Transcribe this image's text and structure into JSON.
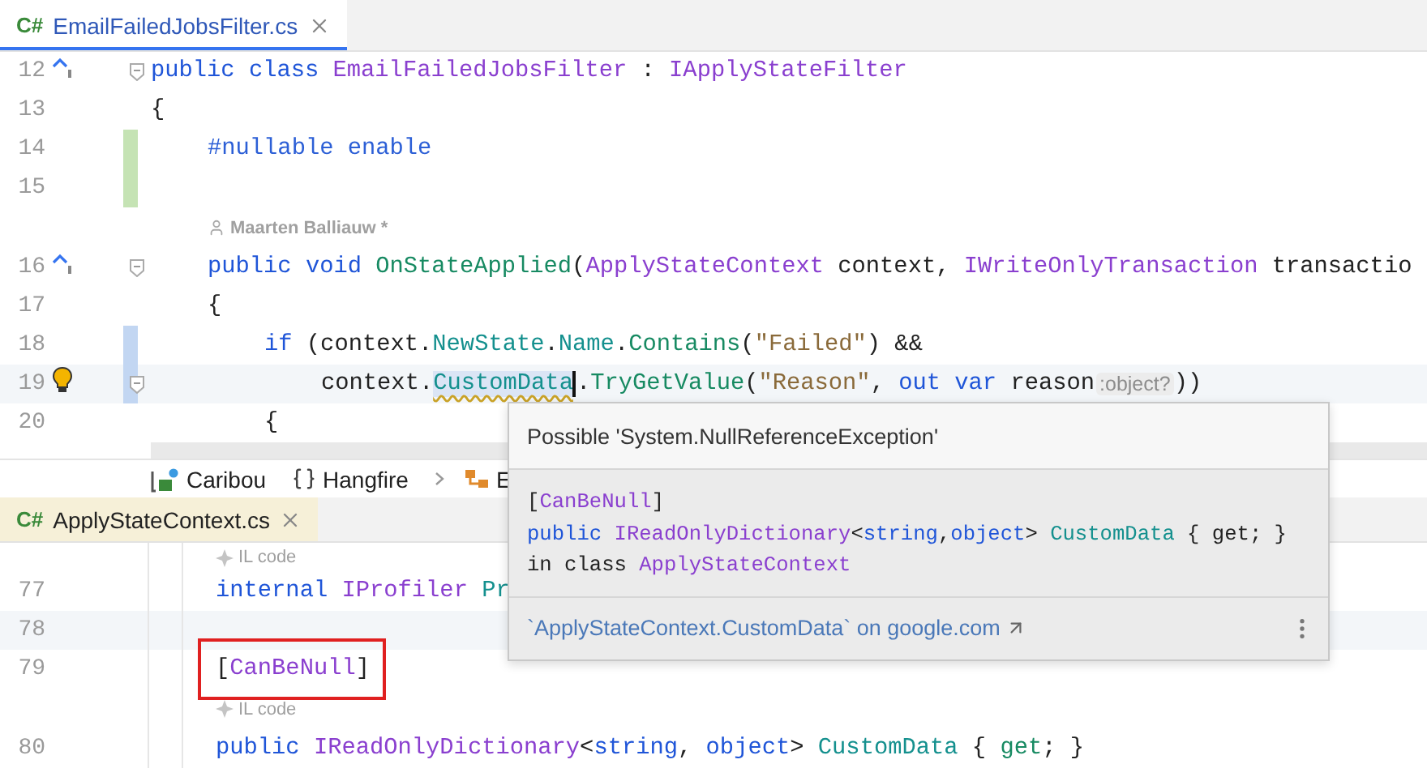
{
  "top_editor": {
    "tab": {
      "lang": "C#",
      "title": "EmailFailedJobsFilter.cs",
      "selected": true,
      "external": false
    },
    "lines": [
      {
        "kind": "code",
        "number": "12",
        "implements": true,
        "bulb": false,
        "added": false,
        "modified": false,
        "fold": true,
        "current": false,
        "tokens": [
          {
            "text": "public class ",
            "kind": "keyword"
          },
          {
            "text": "EmailFailedJobsFilter",
            "kind": "type"
          },
          {
            "text": " : ",
            "kind": "plain"
          },
          {
            "text": "IApplyStateFilter",
            "kind": "type"
          }
        ]
      },
      {
        "kind": "code",
        "number": "13",
        "implements": false,
        "bulb": false,
        "added": false,
        "modified": false,
        "fold": false,
        "current": false,
        "tokens": [
          {
            "text": "{",
            "kind": "plain"
          }
        ],
        "children": [
          {
            "kind": "code",
            "number": "14",
            "implements": false,
            "bulb": false,
            "added": true,
            "modified": false,
            "fold": false,
            "current": false,
            "tokens": [
              {
                "text": "#nullable enable",
                "kind": "directive"
              }
            ]
          },
          {
            "kind": "code",
            "number": "15",
            "implements": false,
            "bulb": false,
            "added": true,
            "modified": false,
            "fold": false,
            "current": false
          },
          {
            "kind": "author",
            "text": "Maarten Balliauw *"
          },
          {
            "kind": "code",
            "number": "16",
            "implements": true,
            "bulb": false,
            "added": false,
            "modified": false,
            "fold": true,
            "current": false,
            "tokens": [
              {
                "text": "public void ",
                "kind": "keyword"
              },
              {
                "text": "OnStateApplied",
                "kind": "method"
              },
              {
                "text": "(",
                "kind": "plain"
              },
              {
                "text": "ApplyStateContext",
                "kind": "type"
              },
              {
                "text": " context, ",
                "kind": "plain"
              },
              {
                "text": "IWriteOnlyTransaction",
                "kind": "type"
              },
              {
                "text": " transactio",
                "kind": "plain"
              }
            ]
          },
          {
            "kind": "code",
            "number": "17",
            "implements": false,
            "bulb": false,
            "added": false,
            "modified": false,
            "fold": false,
            "current": false,
            "tokens": [
              {
                "text": "{",
                "kind": "plain"
              }
            ],
            "children": [
              {
                "kind": "code",
                "number": "18",
                "implements": false,
                "bulb": false,
                "added": false,
                "modified": true,
                "fold": false,
                "current": false,
                "tokens": [
                  {
                    "text": "if ",
                    "kind": "keyword"
                  },
                  {
                    "text": "(context.",
                    "kind": "plain"
                  },
                  {
                    "text": "NewState",
                    "kind": "property"
                  },
                  {
                    "text": ".",
                    "kind": "plain"
                  },
                  {
                    "text": "Name",
                    "kind": "property"
                  },
                  {
                    "text": ".",
                    "kind": "plain"
                  },
                  {
                    "text": "Contains",
                    "kind": "method"
                  },
                  {
                    "text": "(",
                    "kind": "plain"
                  },
                  {
                    "text": "\"Failed\"",
                    "kind": "string"
                  },
                  {
                    "text": ") &&",
                    "kind": "plain"
                  }
                ],
                "children": [
                  {
                    "kind": "code",
                    "number": "19",
                    "implements": false,
                    "bulb": true,
                    "added": false,
                    "modified": true,
                    "fold": true,
                    "current": true,
                    "tokens": [
                      {
                        "text": "context.",
                        "kind": "plain"
                      },
                      {
                        "text": "CustomData",
                        "kind": "flagged"
                      },
                      {
                        "text": ".",
                        "kind": "plain"
                      },
                      {
                        "text": "TryGetValue",
                        "kind": "method"
                      },
                      {
                        "text": "(",
                        "kind": "plain"
                      },
                      {
                        "text": "\"Reason\"",
                        "kind": "string"
                      },
                      {
                        "text": ", ",
                        "kind": "plain"
                      },
                      {
                        "text": "out var ",
                        "kind": "keyword"
                      },
                      {
                        "text": "reason",
                        "kind": "plain"
                      },
                      {
                        "text": ":object?",
                        "kind": "hint"
                      },
                      {
                        "text": "))",
                        "kind": "plain"
                      }
                    ]
                  }
                ]
              },
              {
                "kind": "code",
                "number": "20",
                "implements": false,
                "bulb": false,
                "added": false,
                "modified": false,
                "fold": false,
                "current": false,
                "tokens": [
                  {
                    "text": "{",
                    "kind": "plain"
                  }
                ]
              }
            ]
          }
        ]
      }
    ]
  },
  "breadcrumbs": [
    {
      "kind": "project",
      "label": "Caribou"
    },
    {
      "kind": "namespace",
      "label": "Hangfire"
    },
    {
      "kind": "separator"
    },
    {
      "kind": "class",
      "label": "E"
    }
  ],
  "bottom_editor": {
    "tab": {
      "lang": "C#",
      "title": "ApplyStateContext.cs",
      "selected": false,
      "external": true
    },
    "lines": [
      {
        "kind": "il",
        "text": "IL code"
      },
      {
        "kind": "code",
        "number": "77",
        "current": false,
        "framed": false,
        "tokens": [
          {
            "text": "internal ",
            "kind": "keyword"
          },
          {
            "text": "IProfiler ",
            "kind": "type"
          },
          {
            "text": "Pr",
            "kind": "property"
          }
        ]
      },
      {
        "kind": "code",
        "number": "78",
        "current": true,
        "framed": false
      },
      {
        "kind": "code",
        "number": "79",
        "current": false,
        "framed": true,
        "tokens": [
          {
            "text": "[",
            "kind": "plain"
          },
          {
            "text": "CanBeNull",
            "kind": "type"
          },
          {
            "text": "]",
            "kind": "plain"
          }
        ]
      },
      {
        "kind": "il",
        "text": "IL code"
      },
      {
        "kind": "code",
        "number": "80",
        "current": false,
        "framed": false,
        "tokens": [
          {
            "text": "public ",
            "kind": "keyword"
          },
          {
            "text": "IReadOnlyDictionary",
            "kind": "type"
          },
          {
            "text": "<",
            "kind": "plain"
          },
          {
            "text": "string",
            "kind": "keyword"
          },
          {
            "text": ", ",
            "kind": "plain"
          },
          {
            "text": "object",
            "kind": "keyword"
          },
          {
            "text": "> ",
            "kind": "plain"
          },
          {
            "text": "CustomData",
            "kind": "property"
          },
          {
            "text": " { ",
            "kind": "plain"
          },
          {
            "text": "get",
            "kind": "method"
          },
          {
            "text": "; }",
            "kind": "plain"
          }
        ]
      }
    ]
  },
  "tooltip": {
    "title": "Possible 'System.NullReferenceException'",
    "code": [
      [
        {
          "text": "[",
          "kind": "plain"
        },
        {
          "text": "CanBeNull",
          "kind": "type"
        },
        {
          "text": "]",
          "kind": "plain"
        }
      ],
      [
        {
          "text": "public ",
          "kind": "keyword"
        },
        {
          "text": "IReadOnlyDictionary",
          "kind": "type"
        },
        {
          "text": "<",
          "kind": "plain"
        },
        {
          "text": "string",
          "kind": "keyword"
        },
        {
          "text": ",",
          "kind": "plain"
        },
        {
          "text": "object",
          "kind": "keyword"
        },
        {
          "text": "> ",
          "kind": "plain"
        },
        {
          "text": "CustomData",
          "kind": "property"
        },
        {
          "text": " { get; }",
          "kind": "plain"
        }
      ],
      [
        {
          "text": "in class ",
          "kind": "plain"
        },
        {
          "text": "ApplyStateContext",
          "kind": "type"
        }
      ]
    ],
    "link": "`ApplyStateContext.CustomData` on google.com"
  }
}
